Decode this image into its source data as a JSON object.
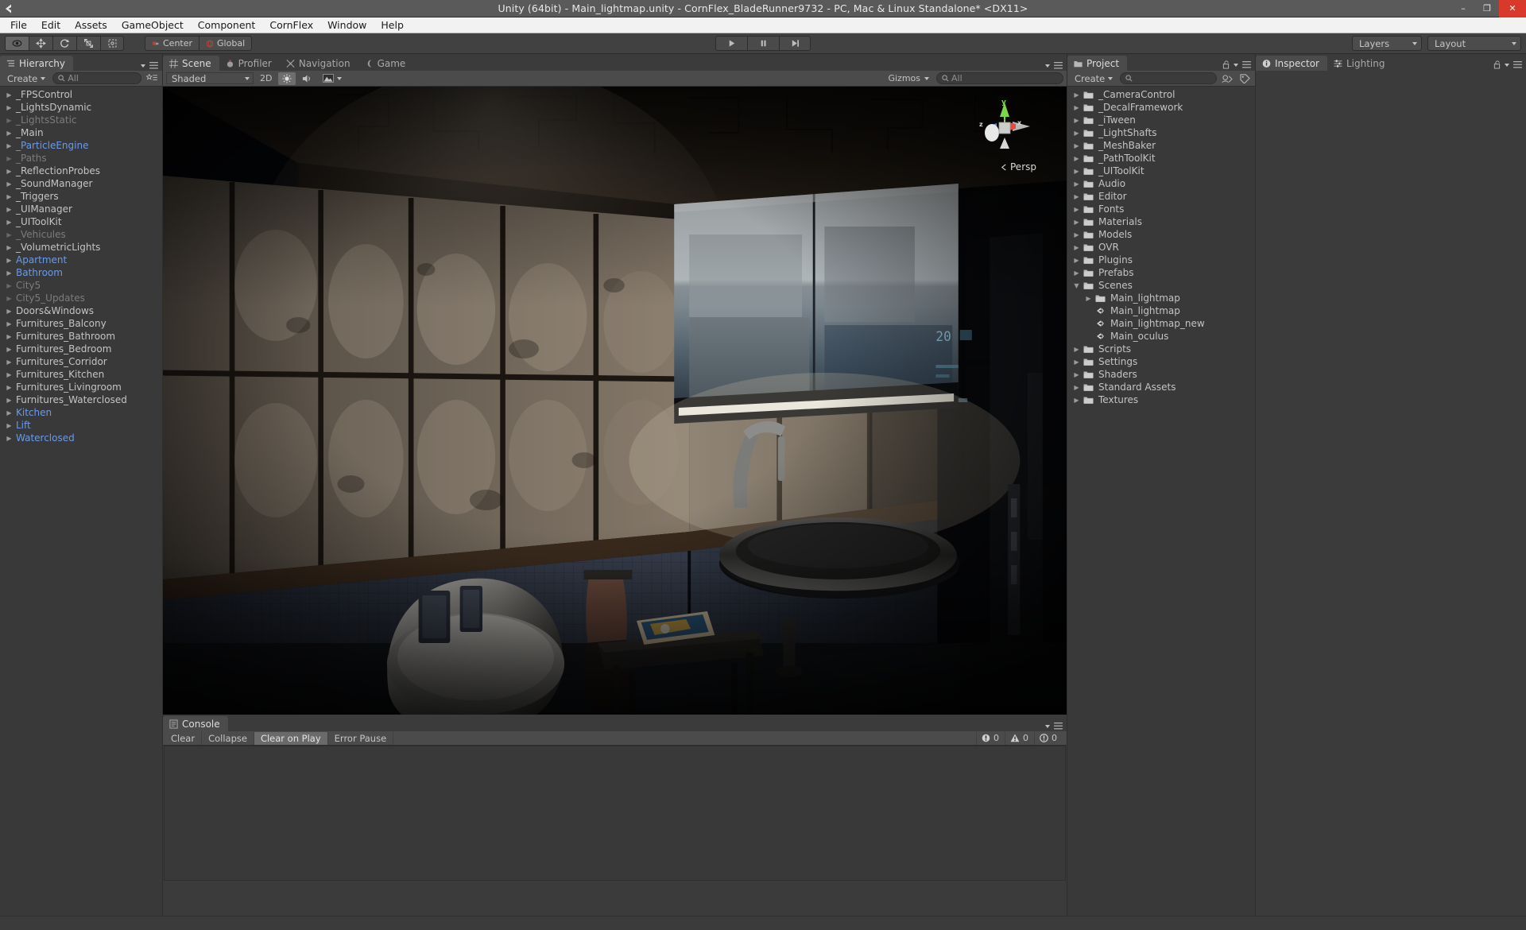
{
  "window": {
    "title": "Unity (64bit) - Main_lightmap.unity - CornFlex_BladeRunner9732 - PC, Mac & Linux Standalone* <DX11>",
    "minimize": "–",
    "maximize": "❐",
    "close": "✕"
  },
  "menu": {
    "items": [
      "File",
      "Edit",
      "Assets",
      "GameObject",
      "Component",
      "CornFlex",
      "Window",
      "Help"
    ]
  },
  "toolbar": {
    "tools": [
      {
        "name": "hand-tool",
        "glyph": "✋",
        "active": true
      },
      {
        "name": "move-tool",
        "glyph": "✚",
        "active": false
      },
      {
        "name": "rotate-tool",
        "glyph": "↻",
        "active": false
      },
      {
        "name": "scale-tool",
        "glyph": "⤡",
        "active": false
      },
      {
        "name": "rect-tool",
        "glyph": "⬚",
        "active": false
      }
    ],
    "pivot_label": "Center",
    "space_label": "Global",
    "play": "▶",
    "pause": "❘❘",
    "step": "▶❙",
    "layers_label": "Layers",
    "layout_label": "Layout"
  },
  "hierarchy": {
    "tab_label": "Hierarchy",
    "create_label": "Create",
    "search_placeholder": "All",
    "items": [
      {
        "label": "_FPSControl",
        "state": "normal"
      },
      {
        "label": "_LightsDynamic",
        "state": "normal"
      },
      {
        "label": "_LightsStatic",
        "state": "dim"
      },
      {
        "label": "_Main",
        "state": "normal"
      },
      {
        "label": "_ParticleEngine",
        "state": "prefab"
      },
      {
        "label": "_Paths",
        "state": "dim"
      },
      {
        "label": "_ReflectionProbes",
        "state": "normal"
      },
      {
        "label": "_SoundManager",
        "state": "normal"
      },
      {
        "label": "_Triggers",
        "state": "normal"
      },
      {
        "label": "_UIManager",
        "state": "normal"
      },
      {
        "label": "_UIToolKit",
        "state": "normal"
      },
      {
        "label": "_Vehicules",
        "state": "dim"
      },
      {
        "label": "_VolumetricLights",
        "state": "normal"
      },
      {
        "label": "Apartment",
        "state": "prefab"
      },
      {
        "label": "Bathroom",
        "state": "prefab"
      },
      {
        "label": "City5",
        "state": "dim"
      },
      {
        "label": "City5_Updates",
        "state": "dim"
      },
      {
        "label": "Doors&Windows",
        "state": "normal"
      },
      {
        "label": "Furnitures_Balcony",
        "state": "normal"
      },
      {
        "label": "Furnitures_Bathroom",
        "state": "normal"
      },
      {
        "label": "Furnitures_Bedroom",
        "state": "normal"
      },
      {
        "label": "Furnitures_Corridor",
        "state": "normal"
      },
      {
        "label": "Furnitures_Kitchen",
        "state": "normal"
      },
      {
        "label": "Furnitures_Livingroom",
        "state": "normal"
      },
      {
        "label": "Furnitures_Waterclosed",
        "state": "normal"
      },
      {
        "label": "Kitchen",
        "state": "prefab"
      },
      {
        "label": "Lift",
        "state": "prefab"
      },
      {
        "label": "Waterclosed",
        "state": "prefab"
      }
    ]
  },
  "scene": {
    "tabs": [
      {
        "label": "Scene",
        "icon": "grid-icon",
        "active": true
      },
      {
        "label": "Profiler",
        "icon": "profiler-icon",
        "active": false
      },
      {
        "label": "Navigation",
        "icon": "navigation-icon",
        "active": false
      },
      {
        "label": "Game",
        "icon": "game-icon",
        "active": false
      }
    ],
    "shading_mode": "Shaded",
    "mode_2d": "2D",
    "lighting_toggle": "☀",
    "audio_toggle": "🔊",
    "fx_label": "◰",
    "gizmos_label": "Gizmos",
    "gizmo_search_placeholder": "All",
    "projection_label": "Persp",
    "axis_x": "x",
    "axis_y": "y",
    "axis_z": "z"
  },
  "console": {
    "tab_label": "Console",
    "clear_label": "Clear",
    "collapse_label": "Collapse",
    "clear_on_play_label": "Clear on Play",
    "error_pause_label": "Error Pause",
    "error_count": "0",
    "warning_count": "0",
    "info_count": "0"
  },
  "project": {
    "tab_label": "Project",
    "create_label": "Create",
    "search_placeholder": "",
    "items": [
      {
        "label": "_CameraControl",
        "type": "folder",
        "indent": 0,
        "expanded": false
      },
      {
        "label": "_DecalFramework",
        "type": "folder",
        "indent": 0,
        "expanded": false
      },
      {
        "label": "_iTween",
        "type": "folder",
        "indent": 0,
        "expanded": false
      },
      {
        "label": "_LightShafts",
        "type": "folder",
        "indent": 0,
        "expanded": false
      },
      {
        "label": "_MeshBaker",
        "type": "folder",
        "indent": 0,
        "expanded": false
      },
      {
        "label": "_PathToolKit",
        "type": "folder",
        "indent": 0,
        "expanded": false
      },
      {
        "label": "_UIToolKit",
        "type": "folder",
        "indent": 0,
        "expanded": false
      },
      {
        "label": "Audio",
        "type": "folder",
        "indent": 0,
        "expanded": false
      },
      {
        "label": "Editor",
        "type": "folder",
        "indent": 0,
        "expanded": false
      },
      {
        "label": "Fonts",
        "type": "folder",
        "indent": 0,
        "expanded": false
      },
      {
        "label": "Materials",
        "type": "folder",
        "indent": 0,
        "expanded": false
      },
      {
        "label": "Models",
        "type": "folder",
        "indent": 0,
        "expanded": false
      },
      {
        "label": "OVR",
        "type": "folder",
        "indent": 0,
        "expanded": false
      },
      {
        "label": "Plugins",
        "type": "folder",
        "indent": 0,
        "expanded": false
      },
      {
        "label": "Prefabs",
        "type": "folder",
        "indent": 0,
        "expanded": false
      },
      {
        "label": "Scenes",
        "type": "folder",
        "indent": 0,
        "expanded": true
      },
      {
        "label": "Main_lightmap",
        "type": "folder",
        "indent": 1,
        "expanded": false
      },
      {
        "label": "Main_lightmap",
        "type": "scene",
        "indent": 1,
        "expanded": null
      },
      {
        "label": "Main_lightmap_new",
        "type": "scene",
        "indent": 1,
        "expanded": null
      },
      {
        "label": "Main_oculus",
        "type": "scene",
        "indent": 1,
        "expanded": null
      },
      {
        "label": "Scripts",
        "type": "folder",
        "indent": 0,
        "expanded": false
      },
      {
        "label": "Settings",
        "type": "folder",
        "indent": 0,
        "expanded": false
      },
      {
        "label": "Shaders",
        "type": "folder",
        "indent": 0,
        "expanded": false
      },
      {
        "label": "Standard Assets",
        "type": "folder",
        "indent": 0,
        "expanded": false
      },
      {
        "label": "Textures",
        "type": "folder",
        "indent": 0,
        "expanded": false
      }
    ]
  },
  "inspector": {
    "tabs": [
      {
        "label": "Inspector",
        "icon": "info-icon",
        "active": true
      },
      {
        "label": "Lighting",
        "icon": "lighting-icon",
        "active": false
      }
    ]
  },
  "colors": {
    "prefab_blue": "#6a9ae8",
    "error_red": "#d9392b",
    "panel_bg": "#393939",
    "toolbar_bg": "#414141",
    "title_bg": "#5a5a5a"
  }
}
